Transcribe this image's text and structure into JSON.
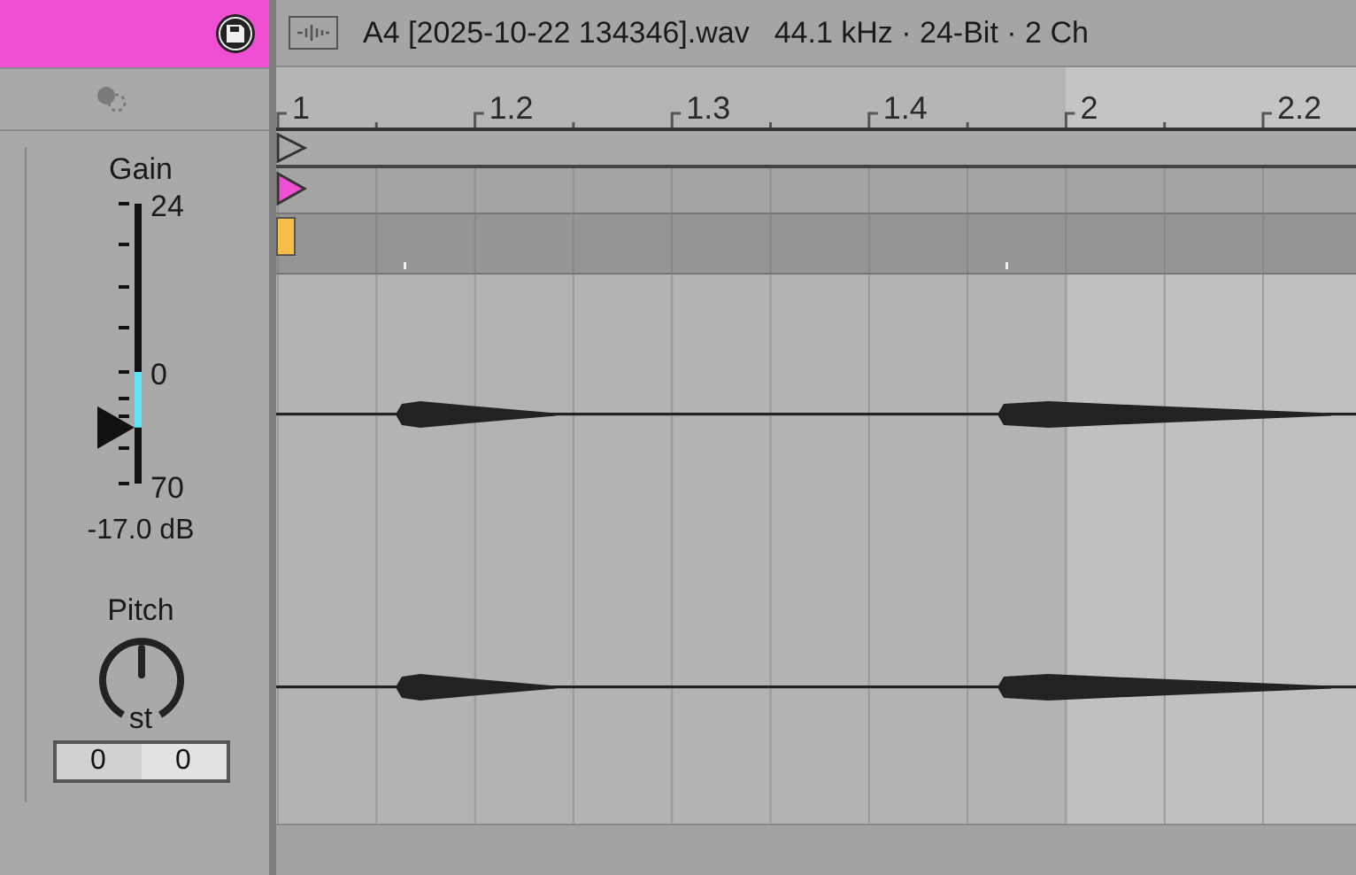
{
  "clip_panel": {
    "gain": {
      "label": "Gain",
      "scale": [
        "24",
        "0",
        "70"
      ],
      "level": 0.2,
      "reading": "-17.0 dB"
    },
    "pitch": {
      "label": "Pitch",
      "unit": "st",
      "fields": [
        "0",
        "0"
      ]
    }
  },
  "sample_editor": {
    "file_name": "A4 [2025-10-22 134346].wav",
    "file_info": "44.1 kHz · 24-Bit · 2 Ch",
    "ruler": [
      "1",
      "1.2",
      "1.3",
      "1.4",
      "2",
      "2.2"
    ]
  }
}
